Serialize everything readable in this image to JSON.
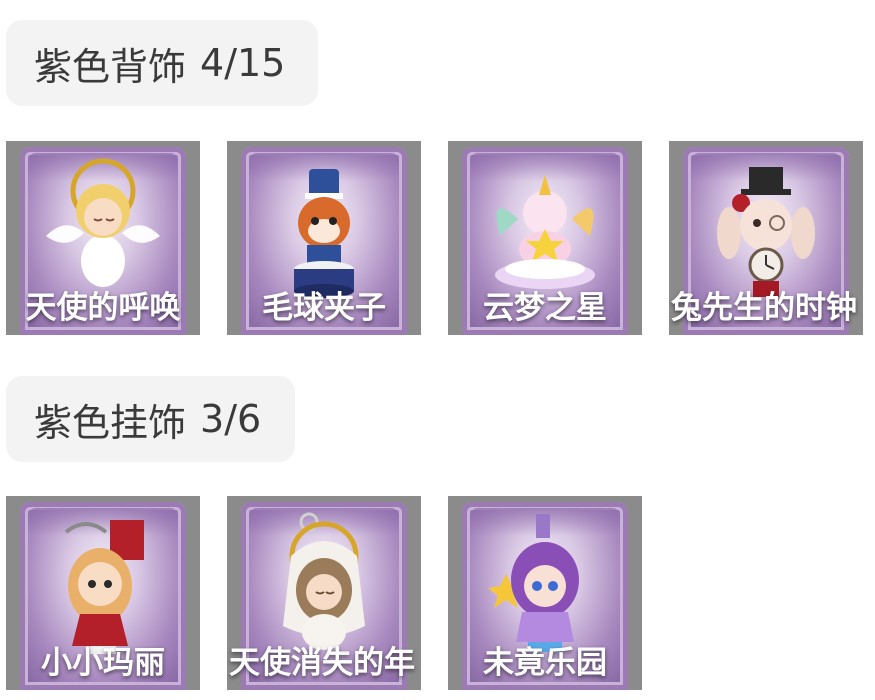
{
  "sections": [
    {
      "title": "紫色背饰",
      "count": "4/15",
      "items": [
        {
          "name": "天使的呼唤",
          "icon": "angel-figure-icon"
        },
        {
          "name": "毛球夹子",
          "icon": "raccoon-drummer-icon"
        },
        {
          "name": "云梦之星",
          "icon": "unicorn-cloud-icon"
        },
        {
          "name": "兔先生的时钟",
          "icon": "bunny-clock-icon"
        }
      ]
    },
    {
      "title": "紫色挂饰",
      "count": "3/6",
      "items": [
        {
          "name": "小小玛丽",
          "icon": "mary-doll-icon"
        },
        {
          "name": "天使消失的年",
          "icon": "angel-girl-charm-icon"
        },
        {
          "name": "未竟乐园",
          "icon": "purple-girl-charm-icon"
        }
      ]
    }
  ],
  "colors": {
    "header_bg": "#f3f3f3",
    "header_text": "#3a3a3a",
    "card_bg": "#8b8b8b",
    "frame_purple": "#a889bf"
  }
}
